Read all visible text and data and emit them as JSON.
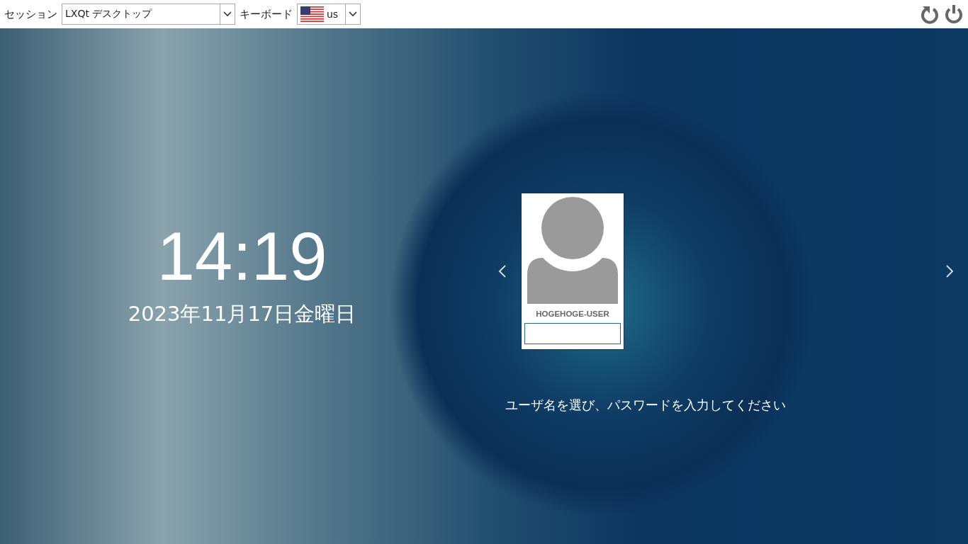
{
  "top_bar": {
    "session_label": "セッション",
    "session_value": "LXQt デスクトップ",
    "keyboard_label": "キーボード",
    "keyboard_value": "us"
  },
  "clock": {
    "time": "14:19",
    "date": "2023年11月17日金曜日"
  },
  "user_card": {
    "name": "HOGEHOGE-USER"
  },
  "message": "ユーザ名を選び、パスワードを入力してください"
}
